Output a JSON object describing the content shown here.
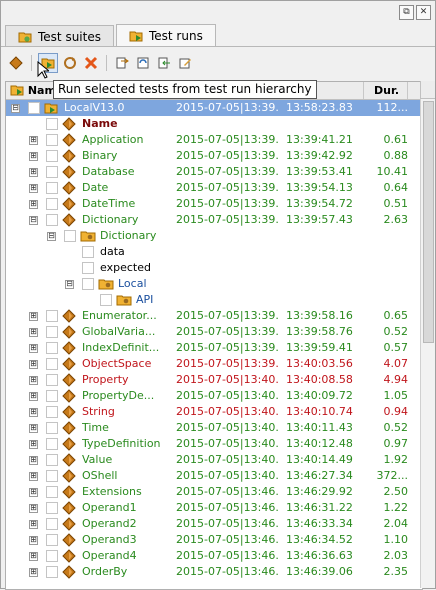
{
  "window": {
    "controls": [
      "⧉",
      "✕"
    ]
  },
  "tabs": [
    {
      "label": "Test suites",
      "icon": "test-suites-icon"
    },
    {
      "label": "Test runs",
      "icon": "test-runs-icon"
    }
  ],
  "toolbar": {
    "buttons": [
      "run-icon",
      "run-selected-icon",
      "refresh-icon",
      "delete-icon",
      "export-icon",
      "reload-icon",
      "import-icon",
      "edit-icon"
    ]
  },
  "tooltip": "Run selected tests from test run hierarchy",
  "columns": {
    "name": "Name",
    "dur": "Dur."
  },
  "rows": [
    {
      "level": 0,
      "exp": "⊟",
      "name": "LocalV13.0",
      "start": "2015-07-05|13:39...",
      "end": "13:58:23.83",
      "dur": "112...",
      "cls": "dark",
      "icon": "run",
      "selected": true
    },
    {
      "level": 1,
      "exp": "",
      "name": "Name",
      "start": "",
      "end": "",
      "dur": "",
      "cls": "darkred",
      "icon": "diamond"
    },
    {
      "level": 1,
      "exp": "⊞",
      "name": "Application",
      "start": "2015-07-05|13:39...",
      "end": "13:39:41.21",
      "dur": "0.61",
      "cls": "green",
      "icon": "diamond"
    },
    {
      "level": 1,
      "exp": "⊞",
      "name": "Binary",
      "start": "2015-07-05|13:39...",
      "end": "13:39:42.92",
      "dur": "0.88",
      "cls": "green",
      "icon": "diamond"
    },
    {
      "level": 1,
      "exp": "⊞",
      "name": "Database",
      "start": "2015-07-05|13:39...",
      "end": "13:39:53.41",
      "dur": "10.41",
      "cls": "green",
      "icon": "diamond"
    },
    {
      "level": 1,
      "exp": "⊞",
      "name": "Date",
      "start": "2015-07-05|13:39...",
      "end": "13:39:54.13",
      "dur": "0.64",
      "cls": "green",
      "icon": "diamond"
    },
    {
      "level": 1,
      "exp": "⊞",
      "name": "DateTime",
      "start": "2015-07-05|13:39...",
      "end": "13:39:54.72",
      "dur": "0.51",
      "cls": "green",
      "icon": "diamond"
    },
    {
      "level": 1,
      "exp": "⊟",
      "name": "Dictionary",
      "start": "2015-07-05|13:39...",
      "end": "13:39:57.43",
      "dur": "2.63",
      "cls": "green",
      "icon": "diamond"
    },
    {
      "level": 2,
      "exp": "⊟",
      "name": "Dictionary",
      "start": "",
      "end": "",
      "dur": "",
      "cls": "green",
      "icon": "folder"
    },
    {
      "level": 3,
      "exp": "",
      "name": "data",
      "start": "",
      "end": "",
      "dur": "",
      "cls": "dark",
      "icon": "none"
    },
    {
      "level": 3,
      "exp": "",
      "name": "expected",
      "start": "",
      "end": "",
      "dur": "",
      "cls": "dark",
      "icon": "none"
    },
    {
      "level": 3,
      "exp": "⊟",
      "name": "Local",
      "start": "",
      "end": "",
      "dur": "",
      "cls": "blue",
      "icon": "folder"
    },
    {
      "level": 4,
      "exp": "",
      "name": "API",
      "start": "",
      "end": "",
      "dur": "",
      "cls": "blue",
      "icon": "folder"
    },
    {
      "level": 1,
      "exp": "⊞",
      "name": "Enumerator...",
      "start": "2015-07-05|13:39...",
      "end": "13:39:58.16",
      "dur": "0.65",
      "cls": "green",
      "icon": "diamond"
    },
    {
      "level": 1,
      "exp": "⊞",
      "name": "GlobalVaria...",
      "start": "2015-07-05|13:39...",
      "end": "13:39:58.76",
      "dur": "0.52",
      "cls": "green",
      "icon": "diamond"
    },
    {
      "level": 1,
      "exp": "⊞",
      "name": "IndexDefinit...",
      "start": "2015-07-05|13:39...",
      "end": "13:39:59.41",
      "dur": "0.57",
      "cls": "green",
      "icon": "diamond"
    },
    {
      "level": 1,
      "exp": "⊞",
      "name": "ObjectSpace",
      "start": "2015-07-05|13:39...",
      "end": "13:40:03.56",
      "dur": "4.07",
      "cls": "red",
      "icon": "diamond"
    },
    {
      "level": 1,
      "exp": "⊞",
      "name": "Property",
      "start": "2015-07-05|13:40...",
      "end": "13:40:08.58",
      "dur": "4.94",
      "cls": "red",
      "icon": "diamond"
    },
    {
      "level": 1,
      "exp": "⊞",
      "name": "PropertyDe...",
      "start": "2015-07-05|13:40...",
      "end": "13:40:09.72",
      "dur": "1.05",
      "cls": "green",
      "icon": "diamond"
    },
    {
      "level": 1,
      "exp": "⊞",
      "name": "String",
      "start": "2015-07-05|13:40...",
      "end": "13:40:10.74",
      "dur": "0.94",
      "cls": "red",
      "icon": "diamond"
    },
    {
      "level": 1,
      "exp": "⊞",
      "name": "Time",
      "start": "2015-07-05|13:40...",
      "end": "13:40:11.43",
      "dur": "0.52",
      "cls": "green",
      "icon": "diamond"
    },
    {
      "level": 1,
      "exp": "⊞",
      "name": "TypeDefinition",
      "start": "2015-07-05|13:40...",
      "end": "13:40:12.48",
      "dur": "0.97",
      "cls": "green",
      "icon": "diamond"
    },
    {
      "level": 1,
      "exp": "⊞",
      "name": "Value",
      "start": "2015-07-05|13:40...",
      "end": "13:40:14.49",
      "dur": "1.92",
      "cls": "green",
      "icon": "diamond"
    },
    {
      "level": 1,
      "exp": "⊞",
      "name": "OShell",
      "start": "2015-07-05|13:40...",
      "end": "13:46:27.34",
      "dur": "372...",
      "cls": "green",
      "icon": "diamond"
    },
    {
      "level": 1,
      "exp": "⊞",
      "name": "Extensions",
      "start": "2015-07-05|13:46...",
      "end": "13:46:29.92",
      "dur": "2.50",
      "cls": "green",
      "icon": "diamond"
    },
    {
      "level": 1,
      "exp": "⊞",
      "name": "Operand1",
      "start": "2015-07-05|13:46...",
      "end": "13:46:31.22",
      "dur": "1.22",
      "cls": "green",
      "icon": "diamond"
    },
    {
      "level": 1,
      "exp": "⊞",
      "name": "Operand2",
      "start": "2015-07-05|13:46...",
      "end": "13:46:33.34",
      "dur": "2.04",
      "cls": "green",
      "icon": "diamond"
    },
    {
      "level": 1,
      "exp": "⊞",
      "name": "Operand3",
      "start": "2015-07-05|13:46...",
      "end": "13:46:34.52",
      "dur": "1.10",
      "cls": "green",
      "icon": "diamond"
    },
    {
      "level": 1,
      "exp": "⊞",
      "name": "Operand4",
      "start": "2015-07-05|13:46...",
      "end": "13:46:36.63",
      "dur": "2.03",
      "cls": "green",
      "icon": "diamond"
    },
    {
      "level": 1,
      "exp": "⊞",
      "name": "OrderBy",
      "start": "2015-07-05|13:46...",
      "end": "13:46:39.06",
      "dur": "2.35",
      "cls": "green",
      "icon": "diamond"
    }
  ],
  "colors": {
    "selection": "#7ea6de",
    "pass": "#2a8a1e",
    "fail": "#c0151b",
    "folder": "#1a4f9e"
  }
}
